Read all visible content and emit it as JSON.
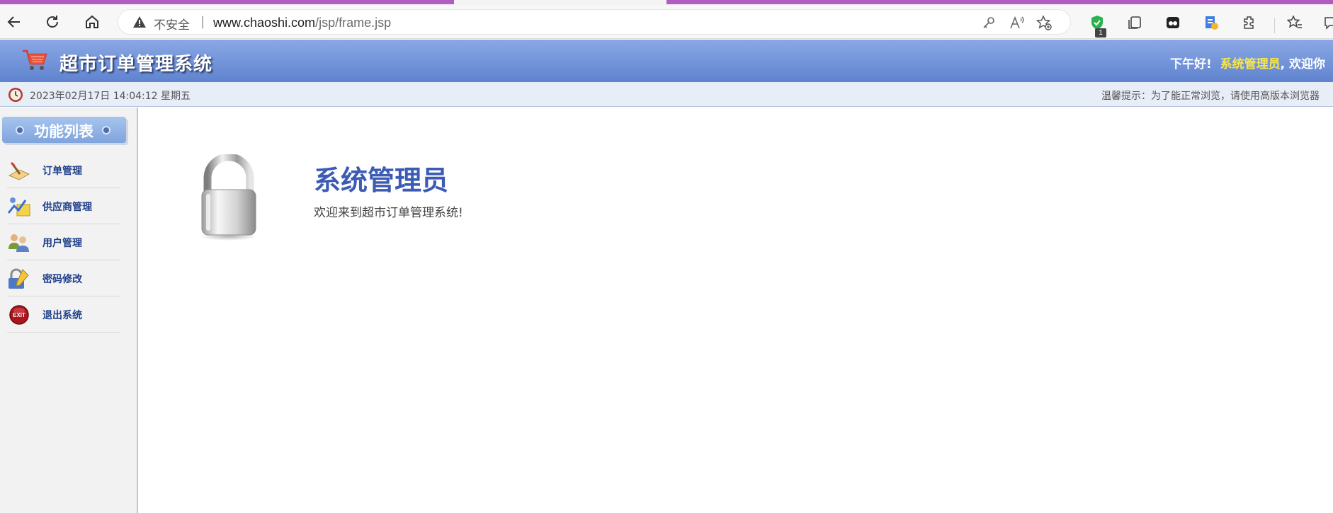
{
  "browser": {
    "address": {
      "security_label": "不安全",
      "separator": "|",
      "host": "www.chaoshi.com",
      "path": "/jsp/frame.jsp"
    },
    "extension_badge": "1"
  },
  "header": {
    "title": "超市订单管理系统",
    "greeting_prefix": "下午好!",
    "user_name": "系统管理员",
    "greeting_suffix": ", 欢迎你"
  },
  "datebar": {
    "datetime": "2023年02月17日 14:04:12 星期五",
    "tip": "温馨提示：为了能正常浏览，请使用高版本浏览器"
  },
  "sidebar": {
    "title": "功能列表",
    "items": [
      {
        "label": "订单管理",
        "icon": "order-icon"
      },
      {
        "label": "供应商管理",
        "icon": "supplier-icon"
      },
      {
        "label": "用户管理",
        "icon": "users-icon"
      },
      {
        "label": "密码修改",
        "icon": "password-icon"
      },
      {
        "label": "退出系统",
        "icon": "exit-icon"
      }
    ]
  },
  "main": {
    "title": "系统管理员",
    "subtitle": "欢迎来到超市订单管理系统!"
  },
  "colors": {
    "header_gradient_top": "#8aa8e4",
    "header_gradient_bottom": "#5f83cf",
    "menu_text": "#1f3f8a",
    "welcome_title": "#3c5bb5",
    "user_name": "#f7e64b",
    "tab_accent": "#b15cc0"
  }
}
